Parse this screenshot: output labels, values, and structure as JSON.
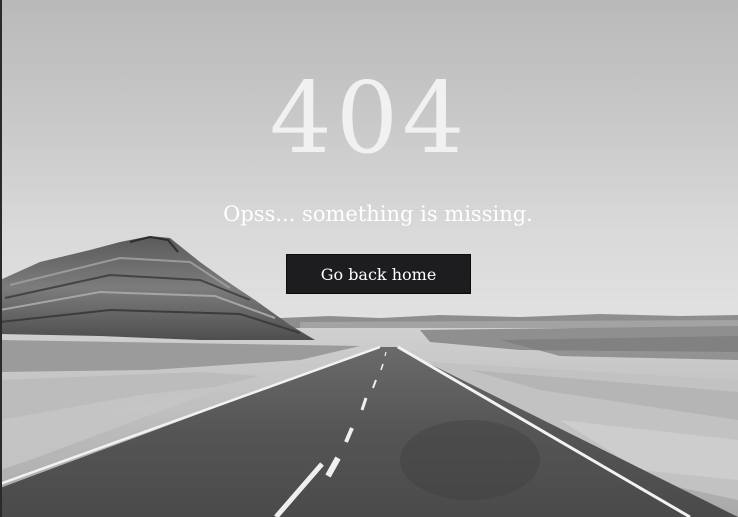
{
  "error": {
    "code": "404",
    "message": "Opss... something is missing."
  },
  "actions": {
    "home_label": "Go back home"
  },
  "background": {
    "description_icon": "desert-road-photo",
    "tone": "grayscale"
  }
}
